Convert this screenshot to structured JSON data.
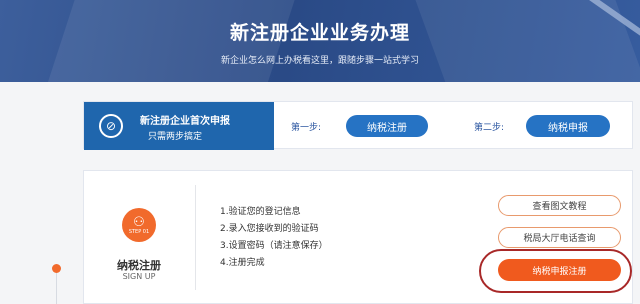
{
  "banner": {
    "title": "新注册企业业务办理",
    "subtitle": "新企业怎么网上办税看这里，跟随步骤一站式学习"
  },
  "steps": {
    "lead_title": "新注册企业首次申报",
    "lead_sub": "只需两步搞定",
    "step1_label": "第一步:",
    "step1_button": "纳税注册",
    "step2_label": "第二步:",
    "step2_button": "纳税申报"
  },
  "card": {
    "badge_step": "STEP 01",
    "name": "纳税注册",
    "name_en": "SIGN UP",
    "items": [
      "1.验证您的登记信息",
      "2.录入您接收到的验证码",
      "3.设置密码（请注意保存）",
      "4.注册完成"
    ],
    "btn_tutorial": "查看图文教程",
    "btn_phone": "税局大厅电话查询",
    "btn_register": "纳税申报注册"
  },
  "colors": {
    "brand_blue": "#1f66ad",
    "accent_orange": "#f05a1e",
    "highlight_red": "#a82828"
  }
}
